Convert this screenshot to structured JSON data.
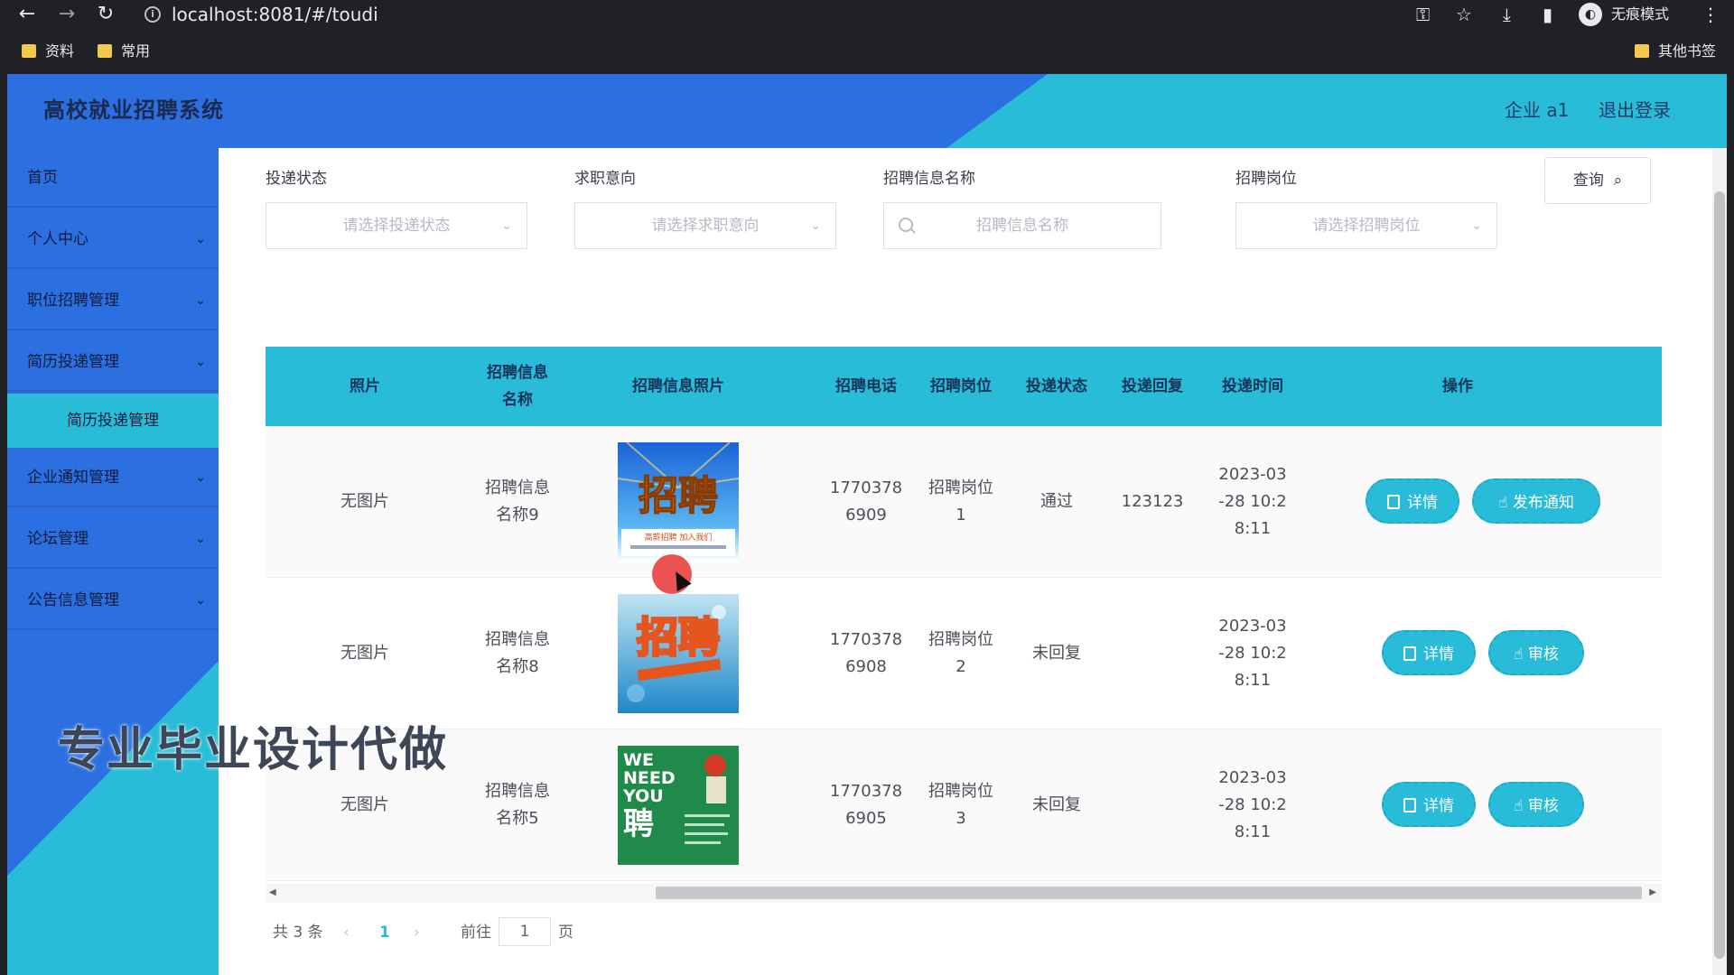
{
  "browser": {
    "url": "localhost:8081/#/toudi",
    "profile_label": "无痕模式",
    "bookmarks": [
      "资料",
      "常用"
    ],
    "other_bookmarks": "其他书签"
  },
  "header": {
    "title": "高校就业招聘系统",
    "user": "企业 a1",
    "logout": "退出登录"
  },
  "sidebar": {
    "items": [
      {
        "label": "首页",
        "expandable": false
      },
      {
        "label": "个人中心",
        "expandable": true
      },
      {
        "label": "职位招聘管理",
        "expandable": true
      },
      {
        "label": "简历投递管理",
        "expandable": true
      },
      {
        "label": "企业通知管理",
        "expandable": true
      },
      {
        "label": "论坛管理",
        "expandable": true
      },
      {
        "label": "公告信息管理",
        "expandable": true
      }
    ],
    "active_sub": "简历投递管理"
  },
  "filters": {
    "status_label": "投递状态",
    "status_placeholder": "请选择投递状态",
    "intent_label": "求职意向",
    "intent_placeholder": "请选择求职意向",
    "name_label": "招聘信息名称",
    "name_placeholder": "招聘信息名称",
    "post_label": "招聘岗位",
    "post_placeholder": "请选择招聘岗位",
    "query_button": "查询"
  },
  "table": {
    "columns": [
      "照片",
      "招聘信息\n名称",
      "招聘信息照片",
      "招聘电话",
      "招聘岗位",
      "投递状态",
      "投递回复",
      "投递时间",
      "操作"
    ],
    "rows": [
      {
        "photo": "无图片",
        "name": "招聘信息\n名称9",
        "poster": "poster-1",
        "phone": "1770378\n6909",
        "post": "招聘岗位\n1",
        "status": "通过",
        "reply": "123123",
        "time": "2023-03\n-28 10:2\n8:11",
        "actions": [
          "详情",
          "发布通知"
        ]
      },
      {
        "photo": "无图片",
        "name": "招聘信息\n名称8",
        "poster": "poster-2",
        "phone": "1770378\n6908",
        "post": "招聘岗位\n2",
        "status": "未回复",
        "reply": "",
        "time": "2023-03\n-28 10:2\n8:11",
        "actions": [
          "详情",
          "审核"
        ]
      },
      {
        "photo": "无图片",
        "name": "招聘信息\n名称5",
        "poster": "poster-3",
        "phone": "1770378\n6905",
        "post": "招聘岗位\n3",
        "status": "未回复",
        "reply": "",
        "time": "2023-03\n-28 10:2\n8:11",
        "actions": [
          "详情",
          "审核"
        ]
      }
    ]
  },
  "posters": {
    "poster-1": {
      "headline": "招聘",
      "tagline": "高薪招聘 加入我们"
    },
    "poster-2": {
      "headline": "招聘"
    },
    "poster-3": {
      "line1": "WE",
      "line2": "NEED",
      "line3": "YOU",
      "headline": "聘"
    }
  },
  "pagination": {
    "total": "共 3 条",
    "current": "1",
    "goto_label": "前往",
    "goto_value": "1",
    "page_suffix": "页"
  },
  "watermark": "专业毕业设计代做",
  "colors": {
    "primary_blue": "#2b6fe0",
    "accent_cyan": "#29bcd8"
  }
}
